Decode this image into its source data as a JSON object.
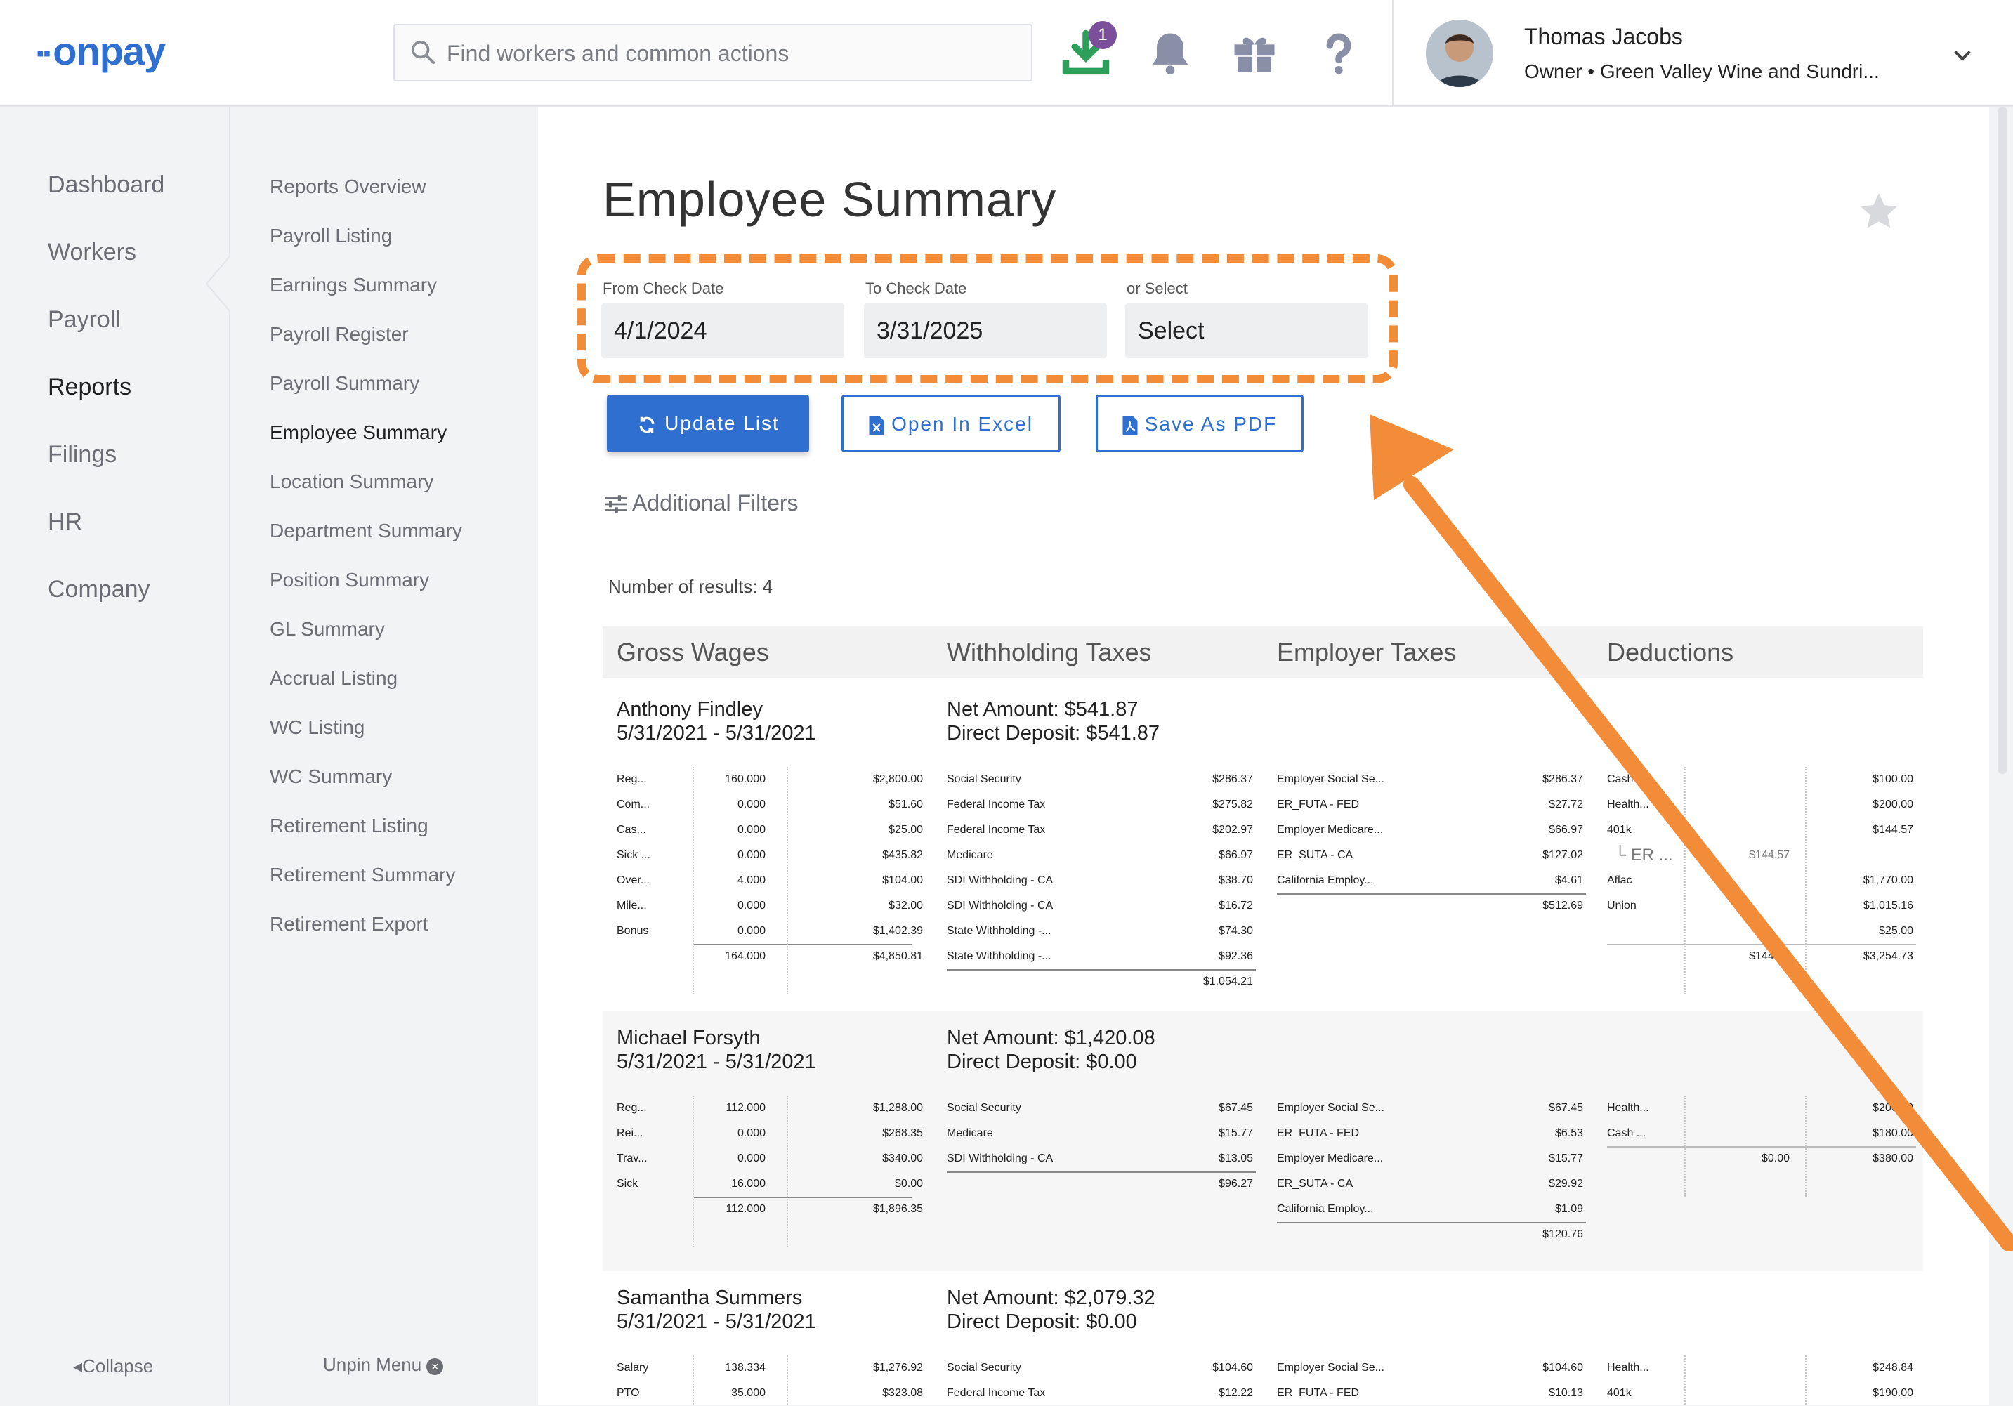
{
  "app": {
    "logo": "onpay",
    "search_placeholder": "Find workers and common actions",
    "download_badge": "1",
    "user_name": "Thomas Jacobs",
    "user_role": "Owner • Green Valley Wine and Sundri..."
  },
  "nav": {
    "items": [
      "Dashboard",
      "Workers",
      "Payroll",
      "Reports",
      "Filings",
      "HR",
      "Company"
    ],
    "active": "Reports",
    "collapse": "Collapse"
  },
  "subnav": {
    "items": [
      "Reports Overview",
      "Payroll Listing",
      "Earnings Summary",
      "Payroll Register",
      "Payroll Summary",
      "Employee Summary",
      "Location Summary",
      "Department Summary",
      "Position Summary",
      "GL Summary",
      "Accrual Listing",
      "WC Listing",
      "WC Summary",
      "Retirement Listing",
      "Retirement Summary",
      "Retirement Export"
    ],
    "active": "Employee Summary",
    "unpin": "Unpin Menu"
  },
  "page": {
    "title": "Employee Summary",
    "from_label": "From Check Date",
    "from_value": "4/1/2024",
    "to_label": "To Check Date",
    "to_value": "3/31/2025",
    "select_label": "or Select",
    "select_value": "Select",
    "update_btn": "Update List",
    "excel_btn": "Open In Excel",
    "pdf_btn": "Save As PDF",
    "filters": "Additional Filters",
    "results": "Number of results: 4",
    "columns": [
      "Gross Wages",
      "Withholding Taxes",
      "Employer Taxes",
      "Deductions"
    ]
  },
  "employees": [
    {
      "name": "Anthony Findley",
      "dates": "5/31/2021  -  5/31/2021",
      "net": "Net Amount: $541.87",
      "deposit": "Direct Deposit: $541.87",
      "wages": [
        [
          "Reg...",
          "160.000",
          "$2,800.00"
        ],
        [
          "Com...",
          "0.000",
          "$51.60"
        ],
        [
          "Cas...",
          "0.000",
          "$25.00"
        ],
        [
          "Sick ...",
          "0.000",
          "$435.82"
        ],
        [
          "Over...",
          "4.000",
          "$104.00"
        ],
        [
          "Mile...",
          "0.000",
          "$32.00"
        ],
        [
          "Bonus",
          "0.000",
          "$1,402.39"
        ]
      ],
      "wages_total": [
        "164.000",
        "$4,850.81"
      ],
      "withholding": [
        [
          "Social Security",
          "$286.37"
        ],
        [
          "Federal Income Tax",
          "$275.82"
        ],
        [
          "Federal Income Tax",
          "$202.97"
        ],
        [
          "Medicare",
          "$66.97"
        ],
        [
          "SDI Withholding - CA",
          "$38.70"
        ],
        [
          "SDI Withholding - CA",
          "$16.72"
        ],
        [
          "State Withholding -...",
          "$74.30"
        ],
        [
          "State Withholding -...",
          "$92.36"
        ]
      ],
      "withholding_total": "$1,054.21",
      "employer": [
        [
          "Employer Social Se...",
          "$286.37"
        ],
        [
          "ER_FUTA - FED",
          "$27.72"
        ],
        [
          "Employer Medicare...",
          "$66.97"
        ],
        [
          "ER_SUTA - CA",
          "$127.02"
        ],
        [
          "California Employ...",
          "$4.61"
        ]
      ],
      "employer_total": "$512.69",
      "deductions": [
        [
          "Cash",
          "",
          "$100.00"
        ],
        [
          "Health...",
          "",
          "$200.00"
        ],
        [
          "401k",
          "",
          "$144.57"
        ],
        [
          "└ ER ...",
          "$144.57",
          ""
        ],
        [
          "Aflac",
          "",
          "$1,770.00"
        ],
        [
          "Union",
          "",
          "$1,015.16"
        ],
        [
          "",
          "",
          "$25.00"
        ]
      ],
      "deductions_total": [
        "$144.57",
        "$3,254.73"
      ]
    },
    {
      "name": "Michael Forsyth",
      "dates": "5/31/2021  -  5/31/2021",
      "net": "Net Amount: $1,420.08",
      "deposit": "Direct Deposit: $0.00",
      "wages": [
        [
          "Reg...",
          "112.000",
          "$1,288.00"
        ],
        [
          "Rei...",
          "0.000",
          "$268.35"
        ],
        [
          "Trav...",
          "0.000",
          "$340.00"
        ],
        [
          "Sick",
          "16.000",
          "$0.00"
        ]
      ],
      "wages_total": [
        "112.000",
        "$1,896.35"
      ],
      "withholding": [
        [
          "Social Security",
          "$67.45"
        ],
        [
          "Medicare",
          "$15.77"
        ],
        [
          "SDI Withholding - CA",
          "$13.05"
        ]
      ],
      "withholding_total": "$96.27",
      "employer": [
        [
          "Employer Social Se...",
          "$67.45"
        ],
        [
          "ER_FUTA - FED",
          "$6.53"
        ],
        [
          "Employer Medicare...",
          "$15.77"
        ],
        [
          "ER_SUTA - CA",
          "$29.92"
        ],
        [
          "California Employ...",
          "$1.09"
        ]
      ],
      "employer_total": "$120.76",
      "deductions": [
        [
          "Health...",
          "",
          "$200.00"
        ],
        [
          "Cash ...",
          "",
          "$180.00"
        ]
      ],
      "deductions_total": [
        "$0.00",
        "$380.00"
      ]
    },
    {
      "name": "Samantha Summers",
      "dates": "5/31/2021  -  5/31/2021",
      "net": "Net Amount: $2,079.32",
      "deposit": "Direct Deposit: $0.00",
      "wages": [
        [
          "Salary",
          "138.334",
          "$1,276.92"
        ],
        [
          "PTO",
          "35.000",
          "$323.08"
        ]
      ],
      "withholding": [
        [
          "Social Security",
          "$104.60"
        ],
        [
          "Federal Income Tax",
          "$12.22"
        ]
      ],
      "employer": [
        [
          "Employer Social Se...",
          "$104.60"
        ],
        [
          "ER_FUTA - FED",
          "$10.13"
        ]
      ],
      "deductions": [
        [
          "Health...",
          "",
          "$248.84"
        ],
        [
          "401k",
          "",
          "$190.00"
        ]
      ]
    }
  ],
  "colors": {
    "brand": "#2f6fd0",
    "annotation": "#f28c38",
    "badge": "#7b4f9a",
    "download": "#2e9e5b"
  }
}
